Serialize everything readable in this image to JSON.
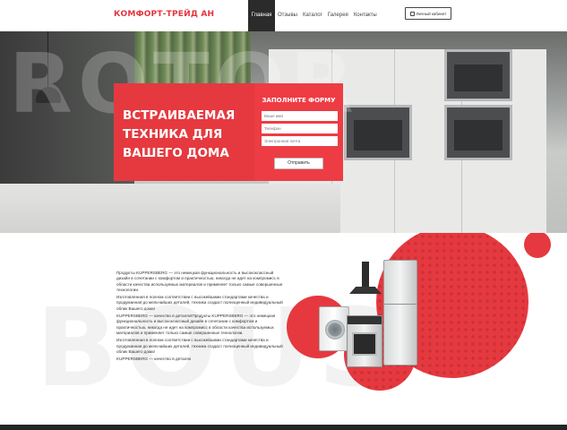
{
  "header": {
    "logo": "КОМФОРТ-ТРЕЙД АН",
    "nav": [
      "Главная",
      "Отзывы",
      "Каталог",
      "Галерея",
      "Контакты"
    ],
    "cabinet_label": "Личный кабинет"
  },
  "hero": {
    "background_word": "ROTOR",
    "title": "ВСТРАИВАЕМАЯ ТЕХНИКА ДЛЯ ВАШЕГО ДОМА",
    "form": {
      "title": "ЗАПОЛНИТЕ ФОРМУ",
      "name_placeholder": "Ваше имя",
      "phone_placeholder": "Телефон",
      "email_placeholder": "Электронная почта",
      "submit_label": "Отправить"
    }
  },
  "about": {
    "background_word": "BOUS",
    "paragraphs": [
      "Продукты KUPPERSBERG — это немецкая функциональность и высококлассный дизайн в сочетании с комфортом и практичностью, никогда не идет на компромисс в области качества используемых материалов и применяет только самые совершенные технологии.",
      "Изготовленная в полном соответствии с высокейшими стандартами качества и продуманная до мельчайших деталей, техника создаст полноценный индивидуальный облик Вашего дома!",
      "KUPPERSBERG — качество в деталях!Продукты KUPPERSBERG — это немецкая функциональность и высококлассный дизайн в сочетании с комфортом и практичностью, никогда не идет на компромисс в области качества используемых материалов и применяет только самые совершенные технологии.",
      "Изготовленная в полном соответствии с высокейшими стандартами качества и продуманная до мельчайших деталей, техника создаст полноценный индивидуальный облик Вашего дома!",
      "KUPPERSBERG — качество в деталях"
    ]
  },
  "colors": {
    "accent": "#e5393f",
    "dark": "#2b2b2b"
  }
}
